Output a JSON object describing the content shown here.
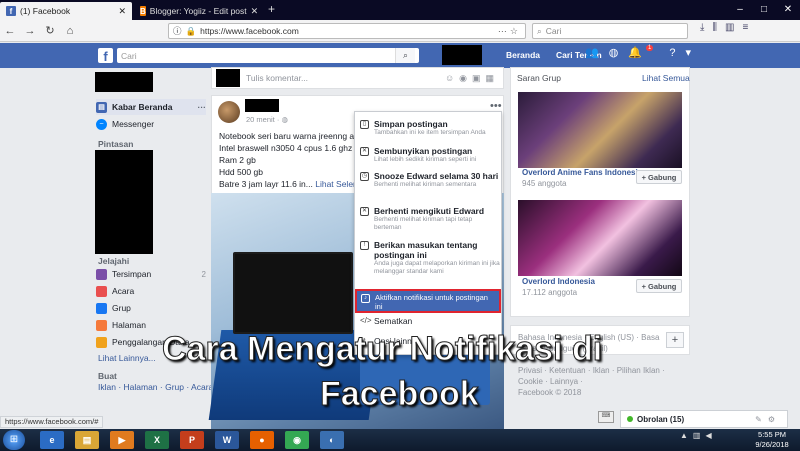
{
  "browser": {
    "tabs": [
      {
        "label": "(1) Facebook",
        "favicon": "f",
        "active": true
      },
      {
        "label": "Blogger: Yogiiz - Edit post",
        "favicon": "B",
        "active": false
      }
    ],
    "new_tab": "+",
    "window_buttons": [
      "–",
      "□",
      "✕"
    ],
    "url": "https://www.facebook.com",
    "search_placeholder": "Cari",
    "nav_icons": {
      "back": "back-arrow-icon",
      "forward": "forward-arrow-icon",
      "reload": "reload-icon",
      "home": "home-icon"
    }
  },
  "facebook": {
    "search_placeholder": "Cari",
    "nav": [
      "Beranda",
      "Cari Teman"
    ],
    "notification_count": "1",
    "colors": {
      "brand": "#4267b2",
      "link": "#365899",
      "highlight_border": "#e0242f"
    }
  },
  "sidebar": {
    "kabar_beranda": "Kabar Beranda",
    "messenger": "Messenger",
    "pintasan_heading": "Pintasan",
    "jelajahi_heading": "Jelajahi",
    "jelajahi": [
      {
        "label": "Tersimpan",
        "count": "2",
        "color": "#7b4fa8",
        "icon": "bookmark-icon"
      },
      {
        "label": "Acara",
        "count": "",
        "color": "#e94f4f",
        "icon": "calendar-icon"
      },
      {
        "label": "Grup",
        "count": "",
        "color": "#1877f2",
        "icon": "group-icon"
      },
      {
        "label": "Halaman",
        "count": "",
        "color": "#f5793b",
        "icon": "flag-icon"
      },
      {
        "label": "Penggalangan Dana",
        "count": "",
        "color": "#f0a21c",
        "icon": "fundraiser-icon"
      }
    ],
    "lihat_lainnya": "Lihat Lainnya...",
    "buat_heading": "Buat",
    "buat_links": "Iklan · Halaman · Grup · Acara"
  },
  "composer": {
    "placeholder": "Tulis komentar..."
  },
  "post": {
    "time": "20 menit",
    "lines": [
      "Notebook seri baru warna jreenng all",
      "Intel braswell n3050 4 cpus 1.6 ghz",
      "Ram 2 gb",
      "Hdd 500 gb",
      "Batre 3 jam layr 11.6 in..."
    ],
    "see_more": "Lihat Selengkapnya"
  },
  "menu": [
    {
      "title": "Simpan postingan",
      "sub": "Tambahkan ini ke item tersimpan Anda",
      "icon": "bookmark-icon"
    },
    {
      "title": "Sembunyikan postingan",
      "sub": "Lihat lebih sedikit kiriman seperti ini",
      "icon": "hide-icon"
    },
    {
      "title": "Snooze Edward selama 30 hari",
      "sub": "Berhenti melihat kiriman sementara",
      "icon": "clock-icon"
    },
    {
      "title": "Berhenti mengikuti Edward",
      "sub": "Berhenti melihat kiriman tapi tetap berteman",
      "icon": "unfollow-icon"
    },
    {
      "title": "Berikan masukan tentang postingan ini",
      "sub": "Anda juga dapat melaporkan kiriman ini jika melanggar standar kami",
      "icon": "feedback-icon"
    }
  ],
  "menu_active": {
    "title": "Aktifkan notifikasi untuk postingan ini",
    "icon": "bell-icon"
  },
  "menu_embed": "Sematkan",
  "menu_more": "Opsi lainnya",
  "right": {
    "saran_title": "Saran Grup",
    "lihat_semua": "Lihat Semua",
    "groups": [
      {
        "name": "Overlord Anime Fans Indonesia",
        "members": "945 anggota",
        "button": "+ Gabung"
      },
      {
        "name": "Overlord Indonesia",
        "members": "17.112 anggota",
        "button": "+ Gabung"
      }
    ],
    "languages": "Bahasa Indonesia · English (US) · Basa Jawa · Português (Brasil)",
    "plus": "+",
    "footer1": "Privasi · Ketentuan · Iklan · Pilihan Iklan ·",
    "footer2": "Cookie · Lainnya ·",
    "copyright": "Facebook © 2018"
  },
  "overlay": {
    "line1": "Cara Mengatur Notifikasi di",
    "line2": "Facebook"
  },
  "status_url": "https://www.facebook.com/#",
  "chat": {
    "label": "Obrolan (15)"
  },
  "taskbar": {
    "apps": [
      {
        "name": "ie",
        "glyph": "e",
        "color": "#2b6cc4"
      },
      {
        "name": "explorer",
        "glyph": "▤",
        "color": "#d9a636"
      },
      {
        "name": "media",
        "glyph": "▶",
        "color": "#e07b1f"
      },
      {
        "name": "excel",
        "glyph": "X",
        "color": "#1e7145"
      },
      {
        "name": "powerpoint",
        "glyph": "P",
        "color": "#c43e1c"
      },
      {
        "name": "word",
        "glyph": "W",
        "color": "#2b579a"
      },
      {
        "name": "firefox",
        "glyph": "●",
        "color": "#e66000"
      },
      {
        "name": "chrome",
        "glyph": "◉",
        "color": "#34a853"
      },
      {
        "name": "other",
        "glyph": "◐",
        "color": "#3a6fb0"
      }
    ],
    "time": "5:55 PM",
    "date": "9/26/2018"
  }
}
